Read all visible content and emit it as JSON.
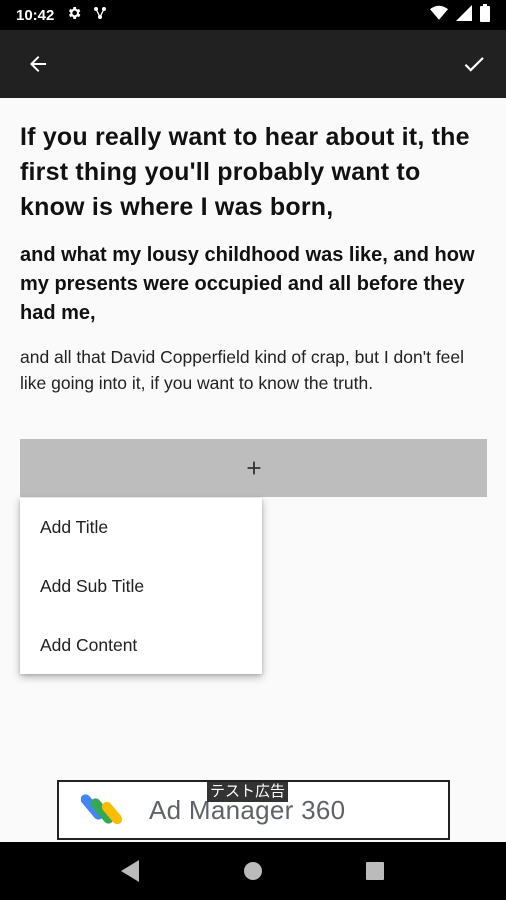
{
  "status_bar": {
    "time": "10:42"
  },
  "app_bar": {
    "back_icon": "arrow-back-icon",
    "confirm_icon": "check-icon"
  },
  "content": {
    "title": "If you really want to hear about it, the first thing you'll probably want to know is where I was born,",
    "subtitle": "and what my lousy childhood was like, and  how my presents were occupied and all before they had me,",
    "body": "and all that David Copperfield kind of crap, but I don't feel like going into it, if you want to know the truth."
  },
  "add_bar": {
    "icon": "plus-icon",
    "label": "+"
  },
  "menu": {
    "items": [
      {
        "label": "Add Title"
      },
      {
        "label": "Add Sub Title"
      },
      {
        "label": "Add Content"
      }
    ]
  },
  "ad": {
    "label": "テスト広告",
    "text": "Ad Manager 360"
  },
  "colors": {
    "app_bar": "#212121",
    "add_bar": "#bdbdbd",
    "background": "#fafafa"
  }
}
